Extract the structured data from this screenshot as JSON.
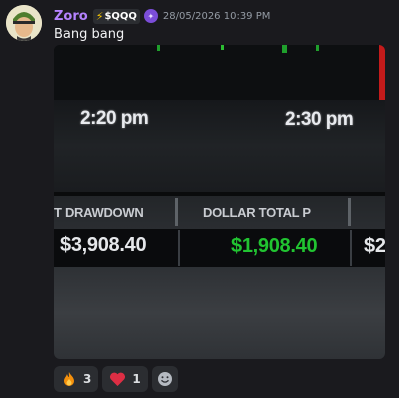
{
  "message": {
    "username": "Zoro",
    "badge_text": "$QQQ",
    "timestamp": "28/05/2026 10:39 PM",
    "text": "Bang bang"
  },
  "attachment": {
    "time_labels": [
      "2:20 pm",
      "2:30 pm"
    ],
    "columns": [
      {
        "header": "T DRAWDOWN",
        "value": "$3,908.40",
        "value_color": "#e5e7ea"
      },
      {
        "header": "DOLLAR TOTAL P",
        "value": "$1,908.40",
        "value_color": "#21c431"
      },
      {
        "header": "",
        "value": "$2",
        "value_color": "#e5e7ea"
      }
    ]
  },
  "reactions": [
    {
      "emoji": "fire-icon",
      "count": "3"
    },
    {
      "emoji": "heart-icon",
      "count": "1"
    }
  ],
  "colors": {
    "username": "#b583ff",
    "profit_green": "#21c431",
    "background": "#1a1a1e"
  }
}
